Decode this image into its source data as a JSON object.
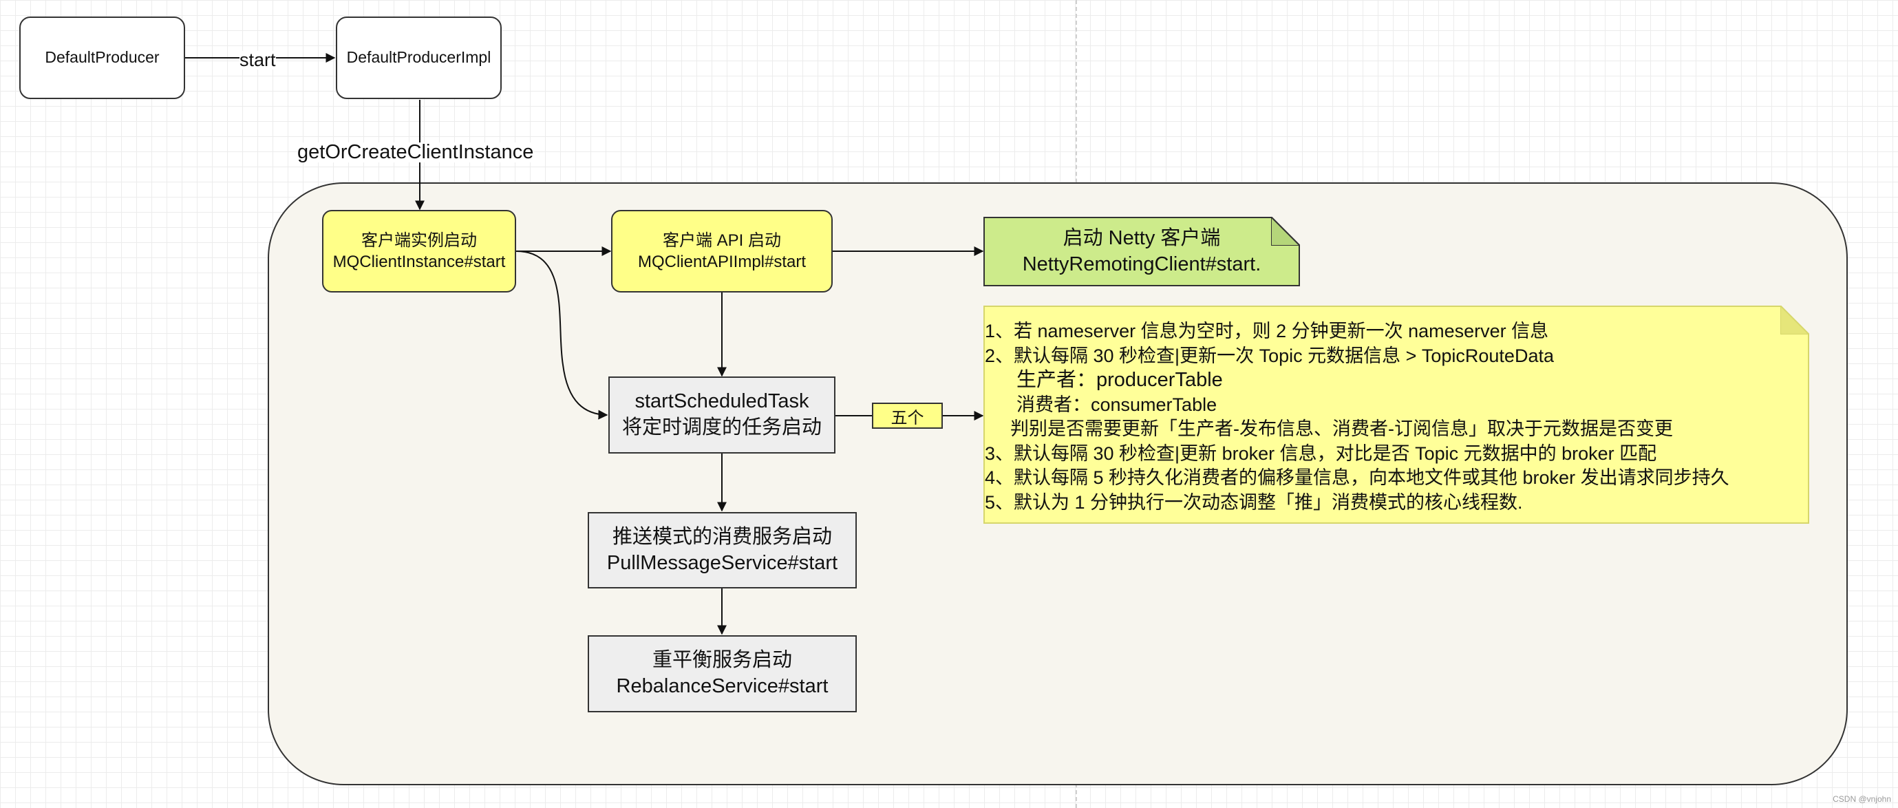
{
  "nodes": {
    "default_producer": "DefaultProducer",
    "default_producer_impl": "DefaultProducerImpl",
    "client_instance": {
      "line1": "客户端实例启动",
      "line2": "MQClientInstance#start"
    },
    "client_api": {
      "line1": "客户端 API 启动",
      "line2": "MQClientAPIImpl#start"
    },
    "netty_client": {
      "line1": "启动 Netty 客户端",
      "line2": "NettyRemotingClient#start."
    },
    "scheduled_task": {
      "line1": "startScheduledTask",
      "line2": "将定时调度的任务启动"
    },
    "pull_service": {
      "line1": "推送模式的消费服务启动",
      "line2": "PullMessageService#start"
    },
    "rebalance_service": {
      "line1": "重平衡服务启动",
      "line2": "RebalanceService#start"
    }
  },
  "edge_labels": {
    "start": "start",
    "get_or_create": "getOrCreateClientInstance",
    "five": "五个"
  },
  "note": {
    "lines": [
      "1、若 nameserver 信息为空时，则 2 分钟更新一次 nameserver 信息",
      "2、默认每隔 30 秒检查|更新一次 Topic 元数据信息 > TopicRouteData",
      "生产者：producerTable",
      "消费者：consumerTable",
      "判别是否需要更新「生产者-发布信息、消费者-订阅信息」取决于元数据是否变更",
      "3、默认每隔 30 秒检查|更新 broker 信息，对比是否 Topic 元数据中的 broker 匹配",
      "4、默认每隔 5 秒持久化消费者的偏移量信息，向本地文件或其他 broker 发出请求同步持久",
      "5、默认为 1 分钟执行一次动态调整「推」消费模式的核心线程数."
    ]
  },
  "watermark": "CSDN @vnjohn",
  "colors": {
    "yellow_node": "#ffff88",
    "note_fill": "#ffff99",
    "netty_fill": "#cdeb8b",
    "container_fill": "#f7f5ee",
    "process_fill": "#eeeeee"
  }
}
